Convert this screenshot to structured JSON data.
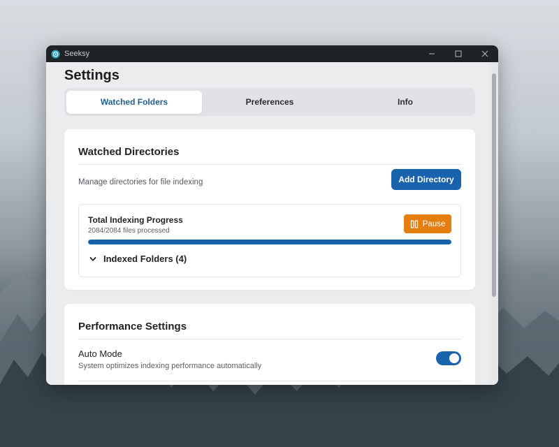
{
  "window": {
    "app_name": "Seeksy"
  },
  "page": {
    "title": "Settings"
  },
  "tabs": [
    {
      "label": "Watched Folders",
      "active": true
    },
    {
      "label": "Preferences",
      "active": false
    },
    {
      "label": "Info",
      "active": false
    }
  ],
  "watched": {
    "title": "Watched Directories",
    "description": "Manage directories for file indexing",
    "add_button": "Add Directory",
    "progress": {
      "title": "Total Indexing Progress",
      "subtitle": "2084/2084 files processed",
      "percent": 100,
      "pause_label": "Pause"
    },
    "folders_label": "Indexed Folders (4)"
  },
  "performance": {
    "title": "Performance Settings",
    "auto_mode": {
      "label": "Auto Mode",
      "description": "System optimizes indexing performance automatically",
      "enabled": true
    }
  },
  "colors": {
    "accent": "#1963ad",
    "pause": "#e67e0f"
  }
}
